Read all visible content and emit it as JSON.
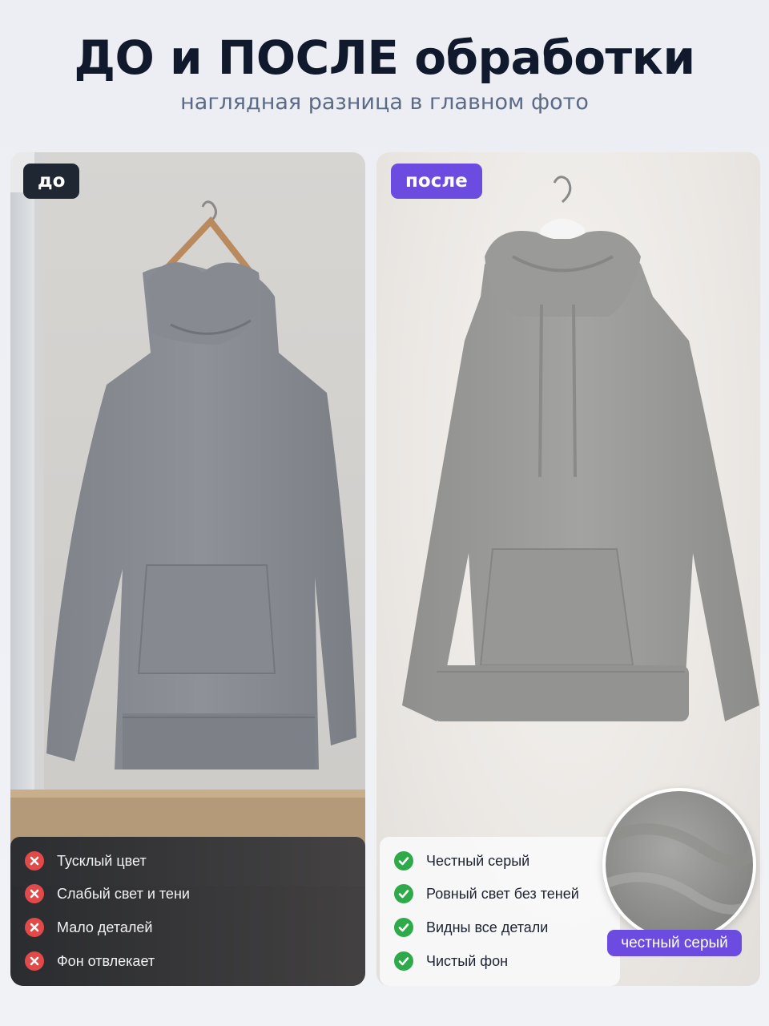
{
  "header": {
    "title": "ДО и ПОСЛЕ обработки",
    "subtitle": "наглядная разница в главном фото"
  },
  "before": {
    "badge": "до",
    "items": [
      {
        "text": "Тусклый цвет",
        "icon": "cross-icon"
      },
      {
        "text": "Слабый свет и тени",
        "icon": "cross-icon"
      },
      {
        "text": "Мало деталей",
        "icon": "cross-icon"
      },
      {
        "text": "Фон отвлекает",
        "icon": "cross-icon"
      }
    ],
    "colors": {
      "status": "#e24a4a"
    }
  },
  "after": {
    "badge": "после",
    "items": [
      {
        "text": "Честный серый",
        "icon": "check-icon"
      },
      {
        "text": "Ровный свет без теней",
        "icon": "check-icon"
      },
      {
        "text": "Видны все детали",
        "icon": "check-icon"
      },
      {
        "text": "Чистый фон",
        "icon": "check-icon"
      }
    ],
    "swatch_label": "честный серый",
    "colors": {
      "status": "#2faa4a",
      "accent": "#6c4be0"
    }
  }
}
